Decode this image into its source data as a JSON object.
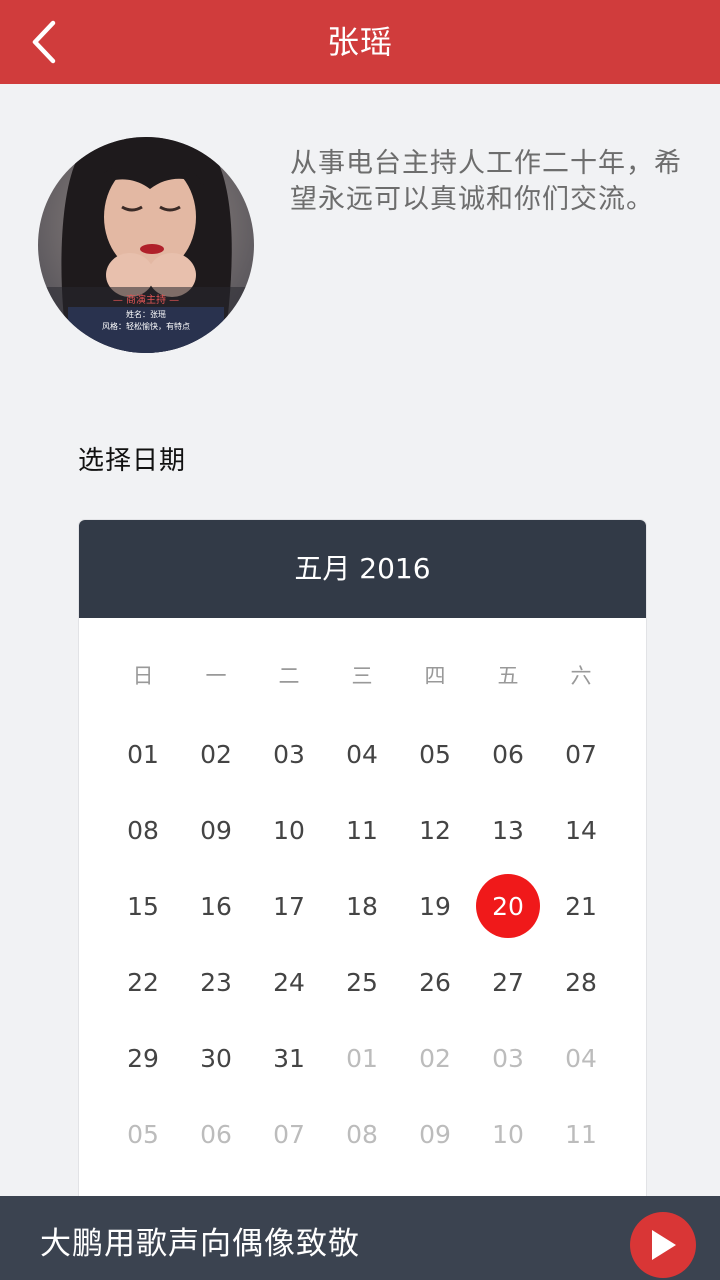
{
  "header": {
    "title": "张瑶"
  },
  "profile": {
    "bio": "从事电台主持人工作二十年，希望永远可以真诚和你们交流。",
    "avatar_caption_title": "— 商演主持 —",
    "avatar_caption_line1": "姓名：张瑶",
    "avatar_caption_line2": "风格：轻松愉快，有特点"
  },
  "date_picker": {
    "label": "选择日期",
    "month_title": "五月 2016",
    "weekdays": [
      "日",
      "一",
      "二",
      "三",
      "四",
      "五",
      "六"
    ],
    "selected_day": "20",
    "weeks": [
      [
        {
          "d": "01",
          "other": false
        },
        {
          "d": "02",
          "other": false
        },
        {
          "d": "03",
          "other": false
        },
        {
          "d": "04",
          "other": false
        },
        {
          "d": "05",
          "other": false
        },
        {
          "d": "06",
          "other": false
        },
        {
          "d": "07",
          "other": false
        }
      ],
      [
        {
          "d": "08",
          "other": false
        },
        {
          "d": "09",
          "other": false
        },
        {
          "d": "10",
          "other": false
        },
        {
          "d": "11",
          "other": false
        },
        {
          "d": "12",
          "other": false
        },
        {
          "d": "13",
          "other": false
        },
        {
          "d": "14",
          "other": false
        }
      ],
      [
        {
          "d": "15",
          "other": false
        },
        {
          "d": "16",
          "other": false
        },
        {
          "d": "17",
          "other": false
        },
        {
          "d": "18",
          "other": false
        },
        {
          "d": "19",
          "other": false
        },
        {
          "d": "20",
          "other": false
        },
        {
          "d": "21",
          "other": false
        }
      ],
      [
        {
          "d": "22",
          "other": false
        },
        {
          "d": "23",
          "other": false
        },
        {
          "d": "24",
          "other": false
        },
        {
          "d": "25",
          "other": false
        },
        {
          "d": "26",
          "other": false
        },
        {
          "d": "27",
          "other": false
        },
        {
          "d": "28",
          "other": false
        }
      ],
      [
        {
          "d": "29",
          "other": false
        },
        {
          "d": "30",
          "other": false
        },
        {
          "d": "31",
          "other": false
        },
        {
          "d": "01",
          "other": true
        },
        {
          "d": "02",
          "other": true
        },
        {
          "d": "03",
          "other": true
        },
        {
          "d": "04",
          "other": true
        }
      ],
      [
        {
          "d": "05",
          "other": true
        },
        {
          "d": "06",
          "other": true
        },
        {
          "d": "07",
          "other": true
        },
        {
          "d": "08",
          "other": true
        },
        {
          "d": "09",
          "other": true
        },
        {
          "d": "10",
          "other": true
        },
        {
          "d": "11",
          "other": true
        }
      ]
    ]
  },
  "player": {
    "title": "大鹏用歌声向偶像致敬"
  },
  "icons": {
    "back": "back-chevron-icon",
    "play": "play-icon"
  },
  "colors": {
    "header_bg": "#d03c3c",
    "calendar_header_bg": "#323a47",
    "selected_day_bg": "#f0191a",
    "player_bg": "#3b4350",
    "play_button": "#d93636"
  }
}
